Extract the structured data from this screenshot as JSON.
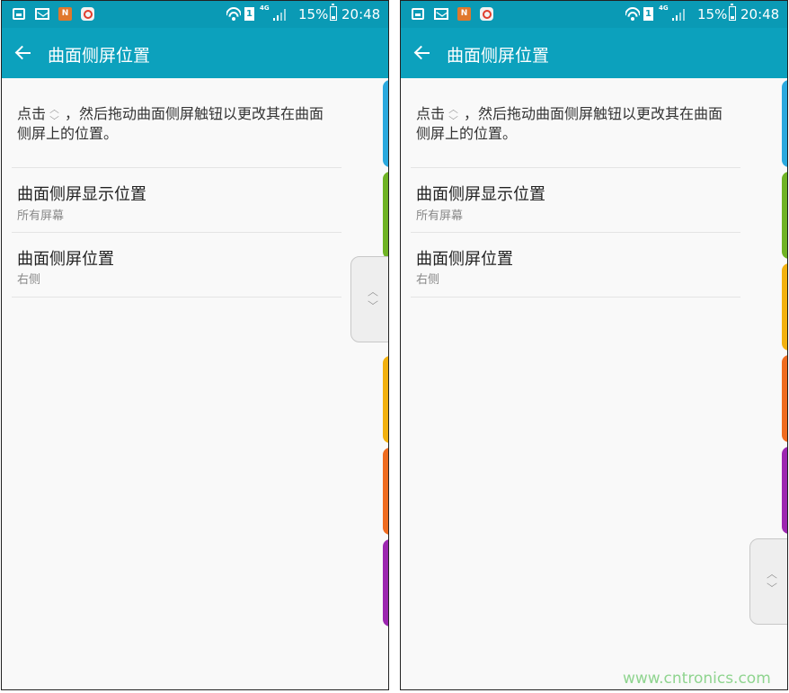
{
  "screens": [
    {
      "status_bar": {
        "app_badge": "N",
        "network": "4G",
        "sim": "1",
        "battery": "15%",
        "time": "20:48"
      },
      "app_bar": {
        "title": "曲面侧屏位置"
      },
      "description": {
        "before_icon": "点击",
        "after_icon": "，然后拖动曲面侧屏触钮以更改其在曲面侧屏上的位置。"
      },
      "items": [
        {
          "title": "曲面侧屏显示位置",
          "subtitle": "所有屏幕"
        },
        {
          "title": "曲面侧屏位置",
          "subtitle": "右侧"
        }
      ],
      "edge_tab_colors": [
        "#2aa9de",
        "#6fb324",
        "#f2b10f",
        "#ef6c20",
        "#9c27b0"
      ]
    },
    {
      "status_bar": {
        "app_badge": "N",
        "network": "4G",
        "sim": "1",
        "battery": "15%",
        "time": "20:48"
      },
      "app_bar": {
        "title": "曲面侧屏位置"
      },
      "description": {
        "before_icon": "点击",
        "after_icon": "，然后拖动曲面侧屏触钮以更改其在曲面侧屏上的位置。"
      },
      "items": [
        {
          "title": "曲面侧屏显示位置",
          "subtitle": "所有屏幕"
        },
        {
          "title": "曲面侧屏位置",
          "subtitle": "右侧"
        }
      ],
      "edge_tab_colors": [
        "#2aa9de",
        "#6fb324",
        "#f2b10f",
        "#ef6c20",
        "#9c27b0"
      ]
    }
  ],
  "watermark": "www.cntronics.com"
}
